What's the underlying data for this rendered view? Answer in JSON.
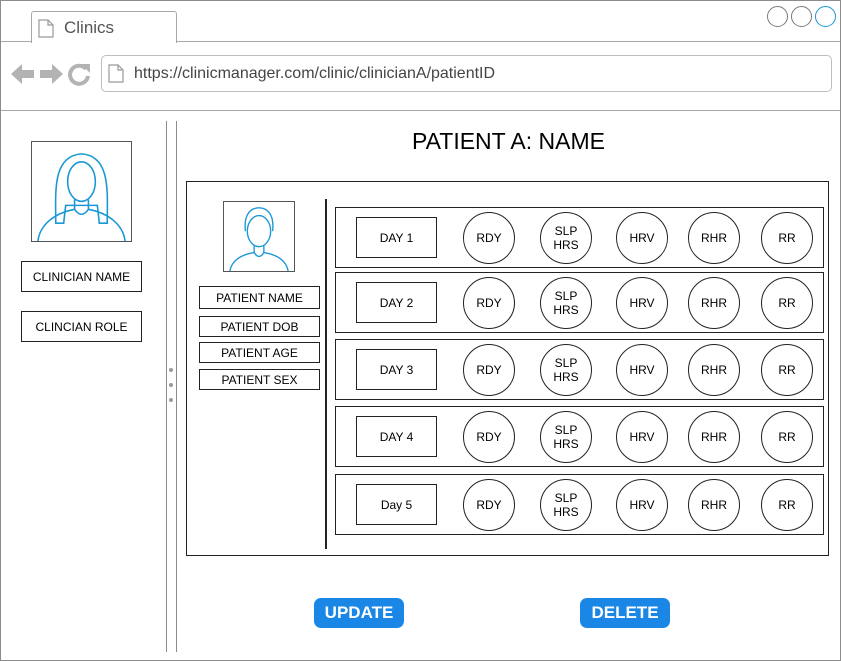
{
  "browser": {
    "tab_title": "Clinics",
    "url": "https://clinicmanager.com/clinic/clinicianA/patientID"
  },
  "sidebar": {
    "clinician_name": "CLINICIAN NAME",
    "clinician_role": "CLINCIAN ROLE"
  },
  "main": {
    "title": "PATIENT A: NAME",
    "patient_fields": [
      "PATIENT NAME",
      "PATIENT DOB",
      "PATIENT AGE",
      "PATIENT SEX"
    ],
    "days": [
      {
        "label": "DAY 1",
        "metrics": [
          "RDY",
          "SLP\nHRS",
          "HRV",
          "RHR",
          "RR"
        ]
      },
      {
        "label": "DAY 2",
        "metrics": [
          "RDY",
          "SLP\nHRS",
          "HRV",
          "RHR",
          "RR"
        ]
      },
      {
        "label": "DAY 3",
        "metrics": [
          "RDY",
          "SLP\nHRS",
          "HRV",
          "RHR",
          "RR"
        ]
      },
      {
        "label": "DAY 4",
        "metrics": [
          "RDY",
          "SLP\nHRS",
          "HRV",
          "RHR",
          "RR"
        ]
      },
      {
        "label": "Day 5",
        "metrics": [
          "RDY",
          "SLP\nHRS",
          "HRV",
          "RHR",
          "RR"
        ]
      }
    ],
    "update_label": "UPDATE",
    "delete_label": "DELETE"
  },
  "colors": {
    "accent": "#1a87e6",
    "avatar_stroke": "#1a98d5"
  },
  "icons": [
    "back-arrow-icon",
    "forward-arrow-icon",
    "reload-icon",
    "document-icon",
    "window-control-icon",
    "avatar-icon",
    "drag-grip-icon"
  ]
}
